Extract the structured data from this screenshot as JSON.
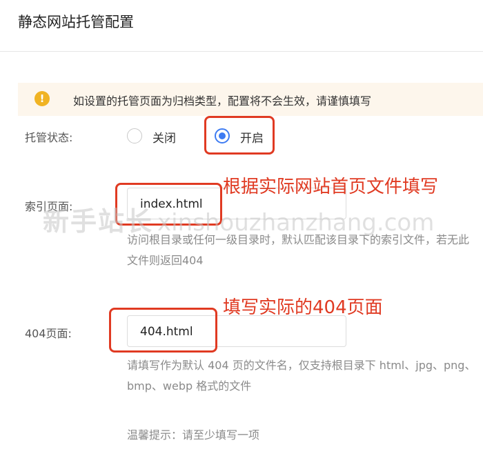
{
  "page": {
    "title": "静态网站托管配置"
  },
  "notice": {
    "icon": "warning-icon",
    "icon_glyph": "!",
    "text": "如设置的托管页面为归档类型，配置将不会生效，请谨慎填写",
    "color": "#fdf6ec"
  },
  "hosting_status": {
    "label": "托管状态:",
    "options": [
      {
        "label": "关闭",
        "selected": false
      },
      {
        "label": "开启",
        "selected": true
      }
    ]
  },
  "index_page": {
    "label": "索引页面:",
    "value": "index.html",
    "help": "访问根目录或任何一级目录时，默认匹配该目录下的索引文件，若无此文件则返回404"
  },
  "error_page": {
    "label": "404页面:",
    "value": "404.html",
    "help": "请填写作为默认 404 页的文件名，仅支持根目录下 html、jpg、png、bmp、webp 格式的文件"
  },
  "tip": "温馨提示：请至少填写一项",
  "annotations": {
    "index_note": "根据实际网站首页文件填写",
    "error_note": "填写实际的404页面"
  },
  "watermark": {
    "cn": "新手站长",
    "en": "xinshouzhanzhang.com"
  },
  "colors": {
    "accent": "#3d7bf2",
    "annotation": "#e03a22",
    "warning": "#f0b323"
  }
}
